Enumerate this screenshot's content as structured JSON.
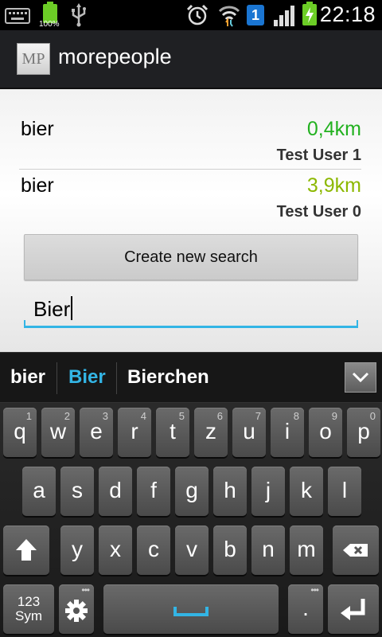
{
  "status_bar": {
    "battery_percent": "100%",
    "notification_badge": "1",
    "time": "22:18",
    "icons": [
      "keyboard-icon",
      "battery-icon",
      "usb-icon",
      "alarm-icon",
      "wifi-icon",
      "notification-badge-icon",
      "signal-icon",
      "battery-charging-icon"
    ]
  },
  "app": {
    "logo_text": "MP",
    "title": "morepeople"
  },
  "results": [
    {
      "query": "bier",
      "distance": "0,4km",
      "distance_color": "#22b11f",
      "user": "Test User 1"
    },
    {
      "query": "bier",
      "distance": "3,9km",
      "distance_color": "#8cb800",
      "user": "Test User 0"
    }
  ],
  "create_button_label": "Create new search",
  "search_input": {
    "value": "Bier"
  },
  "suggestions": {
    "items": [
      "bier",
      "Bier",
      "Bierchen"
    ],
    "active_color": "#33b5e5"
  },
  "keyboard": {
    "row1": [
      {
        "key": "q",
        "hint": "1"
      },
      {
        "key": "w",
        "hint": "2"
      },
      {
        "key": "e",
        "hint": "3"
      },
      {
        "key": "r",
        "hint": "4"
      },
      {
        "key": "t",
        "hint": "5"
      },
      {
        "key": "z",
        "hint": "6"
      },
      {
        "key": "u",
        "hint": "7"
      },
      {
        "key": "i",
        "hint": "8"
      },
      {
        "key": "o",
        "hint": "9"
      },
      {
        "key": "p",
        "hint": "0"
      }
    ],
    "row2": [
      "a",
      "s",
      "d",
      "f",
      "g",
      "h",
      "j",
      "k",
      "l"
    ],
    "row3": [
      "y",
      "x",
      "c",
      "v",
      "b",
      "n",
      "m"
    ],
    "sym_label_top": "123",
    "sym_label_bottom": "Sym",
    "period": ".",
    "dots_hint": "•••",
    "space_color": "#33b5e5"
  }
}
